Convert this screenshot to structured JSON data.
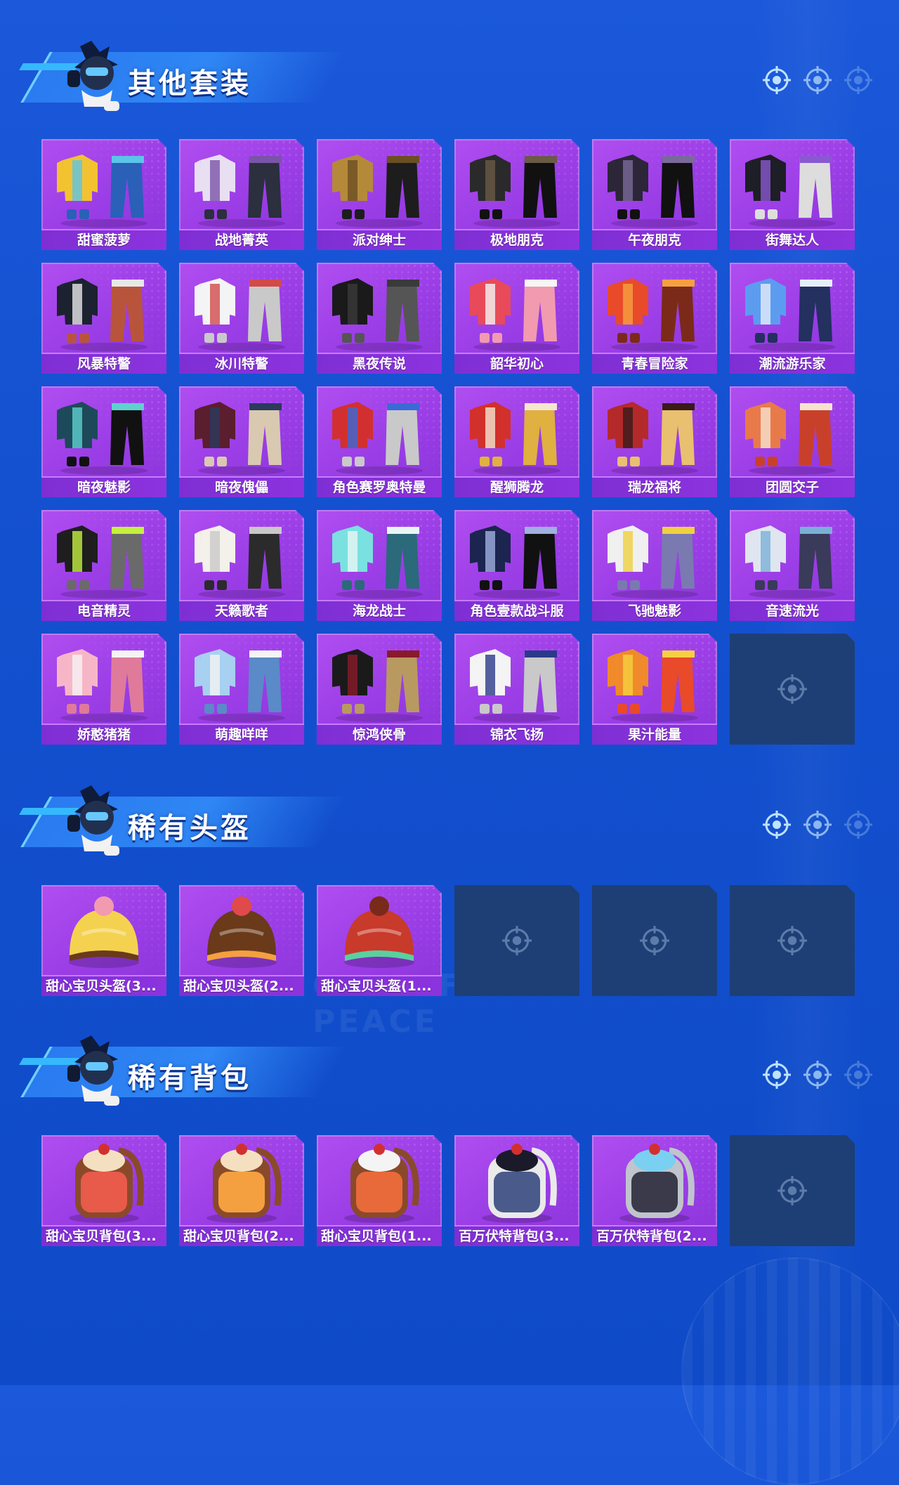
{
  "background_watermark": "GAME FOR PEACE",
  "colors": {
    "background": "#1654d6",
    "card_purple": "#a24be9",
    "label_purple": "#8431da",
    "empty_slot": "#1e3f75",
    "banner_blue": "#2f86f4"
  },
  "sections": [
    {
      "title": "其他套装",
      "page_indicator_icons": [
        "crosshair-icon",
        "crosshair-icon",
        "crosshair-icon-faded"
      ],
      "items": [
        {
          "label": "甜蜜菠萝",
          "art": "outfit-yellow"
        },
        {
          "label": "战地菁英",
          "art": "outfit-stripe"
        },
        {
          "label": "派对绅士",
          "art": "outfit-gold"
        },
        {
          "label": "极地朋克",
          "art": "outfit-black"
        },
        {
          "label": "午夜朋克",
          "art": "outfit-dark-single"
        },
        {
          "label": "街舞达人",
          "art": "outfit-hoodie"
        },
        {
          "label": "风暴特警",
          "art": "outfit-dark-white"
        },
        {
          "label": "冰川特警",
          "art": "outfit-white"
        },
        {
          "label": "黑夜传说",
          "art": "outfit-black-pair"
        },
        {
          "label": "韶华初心",
          "art": "outfit-red-small"
        },
        {
          "label": "青春冒险家",
          "art": "outfit-red-orange"
        },
        {
          "label": "潮流游乐家",
          "art": "outfit-blue"
        },
        {
          "label": "暗夜魅影",
          "art": "outfit-teal-dark"
        },
        {
          "label": "暗夜傀儡",
          "art": "outfit-maroon"
        },
        {
          "label": "角色赛罗奥特曼",
          "art": "outfit-hero"
        },
        {
          "label": "醒狮腾龙",
          "art": "outfit-red-white"
        },
        {
          "label": "瑞龙福将",
          "art": "outfit-red-dark"
        },
        {
          "label": "团圆交子",
          "art": "outfit-orange-white"
        },
        {
          "label": "电音精灵",
          "art": "outfit-black-lime"
        },
        {
          "label": "天籁歌者",
          "art": "outfit-white-pair"
        },
        {
          "label": "海龙战士",
          "art": "outfit-aqua"
        },
        {
          "label": "角色壹款战斗服",
          "art": "outfit-navy-single"
        },
        {
          "label": "飞驰魅影",
          "art": "outfit-white-yellow"
        },
        {
          "label": "音速流光",
          "art": "outfit-silver"
        },
        {
          "label": "娇憨猪猪",
          "art": "outfit-pink"
        },
        {
          "label": "萌趣咩咩",
          "art": "outfit-light-blue"
        },
        {
          "label": "惊鸿侠骨",
          "art": "outfit-black-red"
        },
        {
          "label": "锦衣飞扬",
          "art": "outfit-white-navy"
        },
        {
          "label": "果汁能量",
          "art": "outfit-orange"
        },
        {
          "empty": true
        }
      ]
    },
    {
      "title": "稀有头盔",
      "page_indicator_icons": [
        "crosshair-icon",
        "crosshair-icon",
        "crosshair-icon-faded"
      ],
      "items": [
        {
          "label": "甜心宝贝头盔(3...",
          "art": "helmet-yellow"
        },
        {
          "label": "甜心宝贝头盔(2...",
          "art": "helmet-brown"
        },
        {
          "label": "甜心宝贝头盔(1...",
          "art": "helmet-red"
        },
        {
          "empty": true
        },
        {
          "empty": true
        },
        {
          "empty": true
        }
      ]
    },
    {
      "title": "稀有背包",
      "page_indicator_icons": [
        "crosshair-icon",
        "crosshair-icon",
        "crosshair-icon-faded"
      ],
      "items": [
        {
          "label": "甜心宝贝背包(3...",
          "art": "backpack-sweet-red"
        },
        {
          "label": "甜心宝贝背包(2...",
          "art": "backpack-sweet-orange"
        },
        {
          "label": "甜心宝贝背包(1...",
          "art": "backpack-sweet-stripe"
        },
        {
          "label": "百万伏特背包(3...",
          "art": "backpack-volt-white"
        },
        {
          "label": "百万伏特背包(2...",
          "art": "backpack-volt-grey"
        },
        {
          "empty": true
        }
      ]
    }
  ]
}
